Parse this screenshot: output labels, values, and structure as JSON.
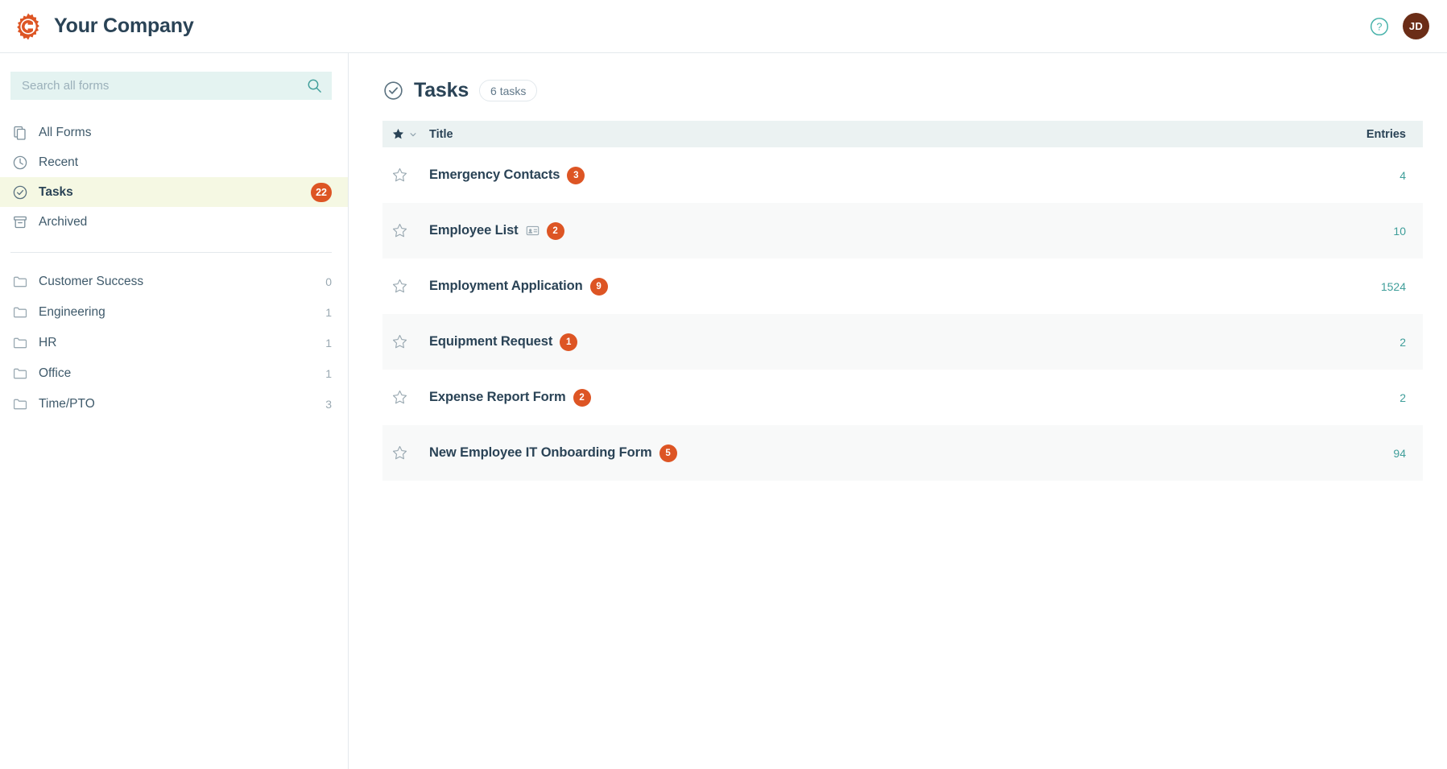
{
  "colors": {
    "brand_orange": "#dd5524",
    "navy": "#2a4356",
    "teal": "#3f9e9a",
    "search_bg": "#e4f3f1",
    "active_row": "#f5f8e3",
    "avatar_bg": "#6b2d17"
  },
  "topbar": {
    "brand_title": "Your Company",
    "logo_icon": "gear-c-logo-icon",
    "help_icon": "question-circle-icon",
    "avatar_initials": "JD"
  },
  "sidebar": {
    "search": {
      "placeholder": "Search all forms",
      "value": "",
      "icon": "search-icon"
    },
    "nav": [
      {
        "id": "all-forms",
        "label": "All Forms",
        "icon": "copy-icon",
        "badge": null,
        "active": false
      },
      {
        "id": "recent",
        "label": "Recent",
        "icon": "clock-icon",
        "badge": null,
        "active": false
      },
      {
        "id": "tasks",
        "label": "Tasks",
        "icon": "check-circle-icon",
        "badge": "22",
        "active": true
      },
      {
        "id": "archived",
        "label": "Archived",
        "icon": "archive-icon",
        "badge": null,
        "active": false
      }
    ],
    "folders": [
      {
        "id": "customer-success",
        "label": "Customer Success",
        "icon": "folder-icon",
        "count": "0"
      },
      {
        "id": "engineering",
        "label": "Engineering",
        "icon": "folder-icon",
        "count": "1"
      },
      {
        "id": "hr",
        "label": "HR",
        "icon": "folder-icon",
        "count": "1"
      },
      {
        "id": "office",
        "label": "Office",
        "icon": "folder-icon",
        "count": "1"
      },
      {
        "id": "time-pto",
        "label": "Time/PTO",
        "icon": "folder-icon",
        "count": "3"
      }
    ]
  },
  "main": {
    "page_icon": "check-circle-icon",
    "page_title": "Tasks",
    "count_pill": "6 tasks",
    "table": {
      "headers": {
        "star": "star-sort-icon",
        "star_chevron": "chevron-down-icon",
        "title": "Title",
        "entries": "Entries"
      },
      "rows": [
        {
          "star": "star-outline-icon",
          "title": "Emergency Contacts",
          "inline_icon": null,
          "badge": "3",
          "entries": "4"
        },
        {
          "star": "star-outline-icon",
          "title": "Employee List",
          "inline_icon": "id-card-icon",
          "badge": "2",
          "entries": "10"
        },
        {
          "star": "star-outline-icon",
          "title": "Employment Application",
          "inline_icon": null,
          "badge": "9",
          "entries": "1524"
        },
        {
          "star": "star-outline-icon",
          "title": "Equipment Request",
          "inline_icon": null,
          "badge": "1",
          "entries": "2"
        },
        {
          "star": "star-outline-icon",
          "title": "Expense Report Form",
          "inline_icon": null,
          "badge": "2",
          "entries": "2"
        },
        {
          "star": "star-outline-icon",
          "title": "New Employee IT Onboarding Form",
          "inline_icon": null,
          "badge": "5",
          "entries": "94"
        }
      ]
    }
  }
}
